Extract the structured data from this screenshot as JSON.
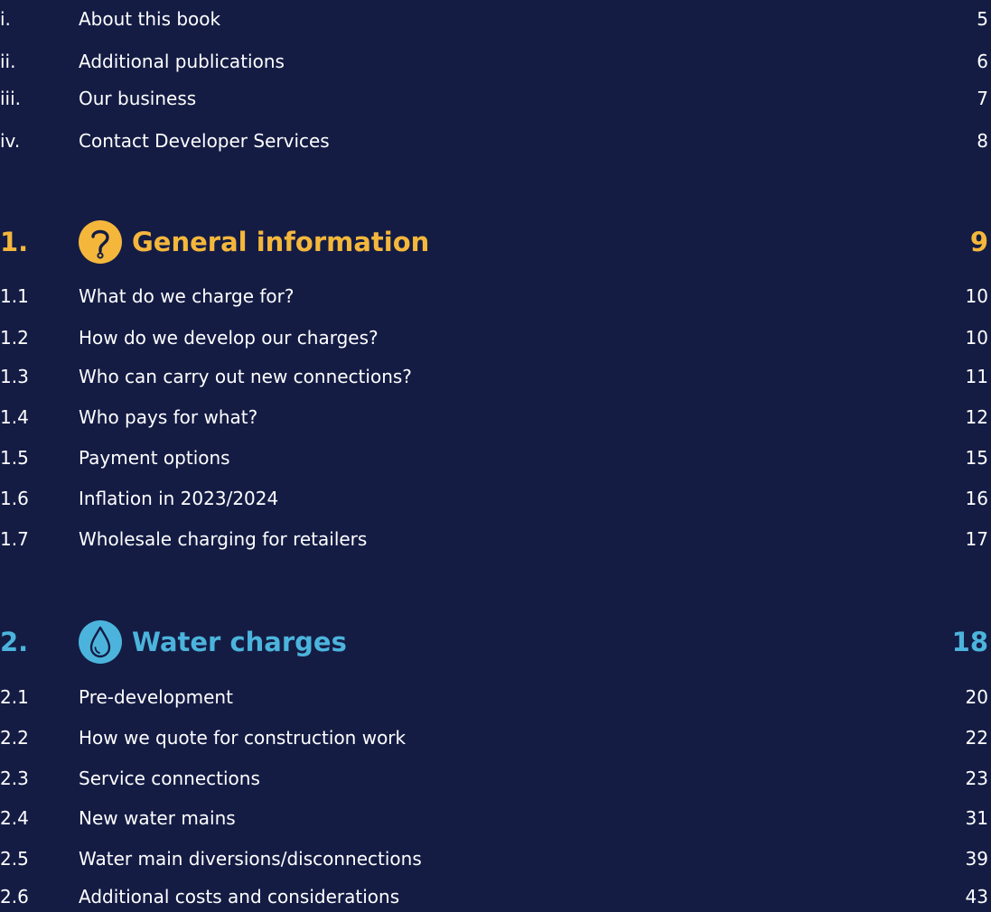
{
  "colors": {
    "background": "#141c44",
    "text": "#ffffff",
    "general_accent": "#f4b73c",
    "water_accent": "#4cb4dc"
  },
  "intro": [
    {
      "num": "i.",
      "title": "About this book",
      "page": "5"
    },
    {
      "num": "ii.",
      "title": "Additional publications",
      "page": "6"
    },
    {
      "num": "iii.",
      "title": "Our business",
      "page": "7"
    },
    {
      "num": "iv.",
      "title": "Contact Developer Services",
      "page": "8"
    }
  ],
  "sections": [
    {
      "num": "1.",
      "title": "General information",
      "page": "9",
      "icon": "question-mark-icon",
      "items": [
        {
          "num": "1.1",
          "title": "What do we charge for?",
          "page": "10"
        },
        {
          "num": "1.2",
          "title": "How do we develop our charges?",
          "page": "10"
        },
        {
          "num": "1.3",
          "title": "Who can carry out new connections?",
          "page": "11"
        },
        {
          "num": "1.4",
          "title": "Who pays for what?",
          "page": "12"
        },
        {
          "num": "1.5",
          "title": "Payment options",
          "page": "15"
        },
        {
          "num": "1.6",
          "title": "Inflation in 2023/2024",
          "page": "16"
        },
        {
          "num": "1.7",
          "title": "Wholesale charging for retailers",
          "page": "17"
        }
      ]
    },
    {
      "num": "2.",
      "title": "Water charges",
      "page": "18",
      "icon": "water-drop-icon",
      "items": [
        {
          "num": "2.1",
          "title": "Pre-development",
          "page": "20"
        },
        {
          "num": "2.2",
          "title": "How we quote for construction work",
          "page": "22"
        },
        {
          "num": "2.3",
          "title": "Service connections",
          "page": "23"
        },
        {
          "num": "2.4",
          "title": "New water mains",
          "page": "31"
        },
        {
          "num": "2.5",
          "title": "Water main diversions/disconnections",
          "page": "39"
        },
        {
          "num": "2.6",
          "title": "Additional costs and considerations",
          "page": "43"
        }
      ]
    }
  ]
}
